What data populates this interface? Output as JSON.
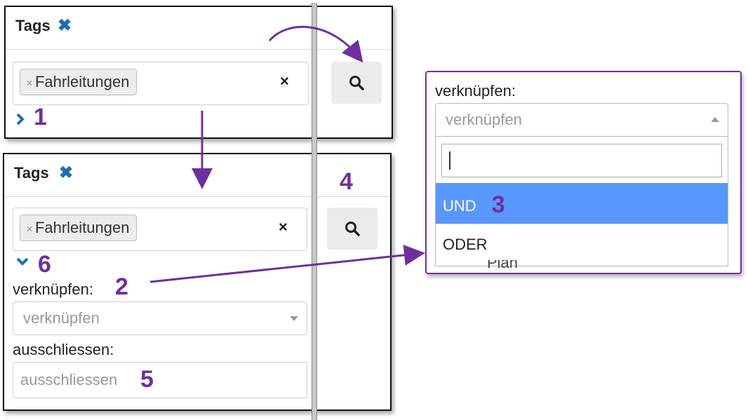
{
  "colors": {
    "accent": "#1e6fb5",
    "annotation": "#6f2f9f",
    "selected": "#5897fb"
  },
  "top_panel": {
    "title": "Tags",
    "title_icon": "close-x-icon",
    "tag_chip": {
      "remove": "×",
      "label": "Fahrleitungen"
    },
    "clear": "×",
    "search_icon": "search-icon",
    "chevron_icon": "chevron-right-icon",
    "step_number": "1"
  },
  "bottom_panel": {
    "title": "Tags",
    "title_icon": "close-x-icon",
    "tag_chip": {
      "remove": "×",
      "label": "Fahrleitungen"
    },
    "clear": "×",
    "search_icon": "search-icon",
    "search_step": "4",
    "chevron_icon": "chevron-down-icon",
    "chevron_step": "6",
    "link_label": "verknüpfen:",
    "link_step": "2",
    "link_placeholder": "verknüpfen",
    "exclude_label": "ausschliessen:",
    "exclude_placeholder": "ausschliessen",
    "exclude_step": "5"
  },
  "dropdown": {
    "label": "verknüpfen:",
    "placeholder": "verknüpfen",
    "search_value": "",
    "options": [
      {
        "label": "UND",
        "selected": true
      },
      {
        "label": "ODER",
        "selected": false
      }
    ],
    "selected_step": "3",
    "partial_hidden_text": "Plan"
  }
}
